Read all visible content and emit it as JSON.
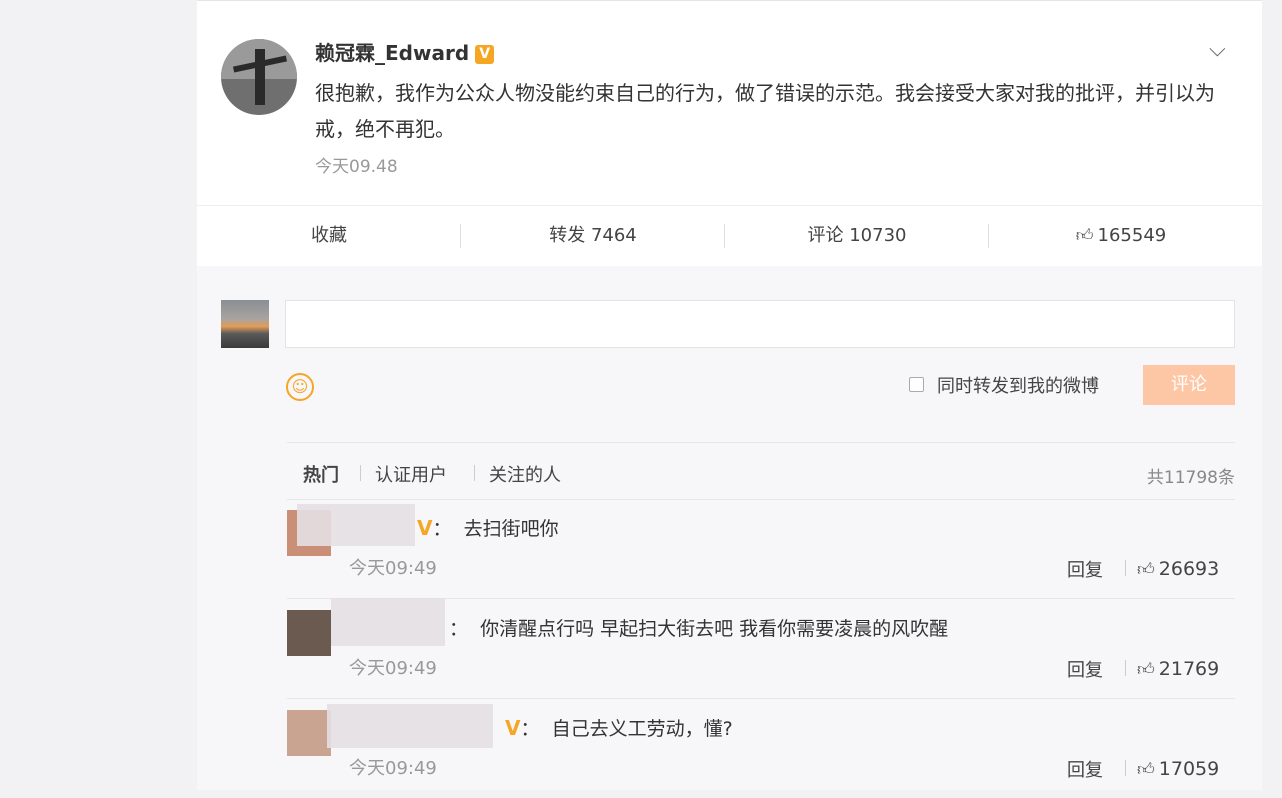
{
  "post": {
    "username": "赖冠霖_Edward",
    "verified_badge": "V",
    "text": "很抱歉，我作为公众人物没能约束自己的行为，做了错误的示范。我会接受大家对我的批评，并引以为戒，绝不再犯。",
    "time": "今天09.48"
  },
  "actions": {
    "favorite": "收藏",
    "repost": "转发 7464",
    "comment": "评论 10730",
    "like": "165549"
  },
  "composer": {
    "placeholder": "",
    "also_repost_label": "同时转发到我的微博",
    "submit_label": "评论"
  },
  "tabs": {
    "hot": "热门",
    "verified": "认证用户",
    "following": "关注的人",
    "total": "共11798条"
  },
  "comments": [
    {
      "text": "去扫街吧你",
      "time": "今天09:49",
      "reply": "回复",
      "likes": "26693"
    },
    {
      "text": "你清醒点行吗 早起扫大街去吧 我看你需要凌晨的风吹醒",
      "time": "今天09:49",
      "reply": "回复",
      "likes": "21769"
    },
    {
      "text": "自己去义工劳动，懂?",
      "time": "今天09:49",
      "reply": "回复",
      "likes": "17059"
    }
  ],
  "icons": {
    "more": "chevron-down-icon",
    "like": "thumbs-up-icon",
    "emoji": "smiley-icon"
  },
  "colors": {
    "accent": "#f5a623",
    "submit_button": "#fdc7a5"
  }
}
